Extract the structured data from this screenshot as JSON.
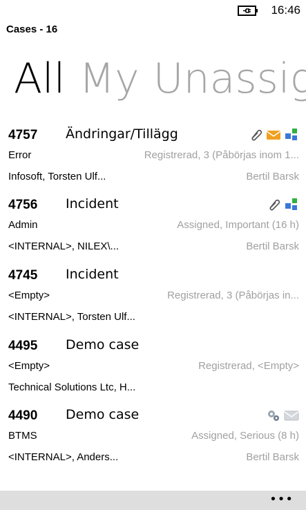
{
  "status": {
    "time": "16:46"
  },
  "app": {
    "title": "Cases - 16"
  },
  "pivot": {
    "items": [
      "All",
      "My",
      "Unassig"
    ]
  },
  "cases": [
    {
      "id": "4757",
      "title": "Ändringar/Tillägg",
      "category": "Error",
      "status": "Registrerad, 3 (Påbörjas inom 1...",
      "customer": "Infosoft, Torsten Ulf...",
      "assignee": "Bertil Barsk",
      "icons": [
        "paperclip-icon",
        "mail-icon",
        "network-icon"
      ]
    },
    {
      "id": "4756",
      "title": "Incident",
      "category": "Admin",
      "status": "Assigned, Important (16 h)",
      "customer": "<INTERNAL>, NILEX\\...",
      "assignee": "Bertil Barsk",
      "icons": [
        "paperclip-icon",
        "network-icon"
      ]
    },
    {
      "id": "4745",
      "title": "Incident",
      "category": "<Empty>",
      "status": "Registrerad, 3 (Påbörjas in...",
      "customer": "<INTERNAL>, Torsten Ulf...",
      "assignee": "",
      "icons": []
    },
    {
      "id": "4495",
      "title": "Demo case",
      "category": "<Empty>",
      "status": "Registrerad, <Empty>",
      "customer": "Technical Solutions Ltc, H...",
      "assignee": "",
      "icons": []
    },
    {
      "id": "4490",
      "title": "Demo case",
      "category": "BTMS",
      "status": "Assigned, Serious (8 h)",
      "customer": "<INTERNAL>, Anders...",
      "assignee": "Bertil Barsk",
      "icons": [
        "gears-icon",
        "mail-grey-icon"
      ]
    }
  ],
  "appbar": {
    "more": "•••"
  },
  "colors": {
    "inactive_pivot": "#a6a6a6",
    "secondary_text": "#a0a0a0",
    "appbar": "#dedede",
    "mail": "#f0a020",
    "network_green": "#2fb040",
    "network_blue": "#3a78d8"
  }
}
